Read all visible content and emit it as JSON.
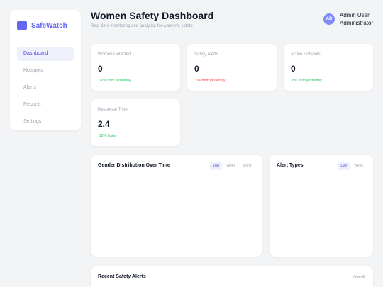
{
  "brand": {
    "name": "SafeWatch"
  },
  "nav": {
    "items": [
      {
        "label": "Dashboard"
      },
      {
        "label": "Hotspots"
      },
      {
        "label": "Alerts"
      },
      {
        "label": "Reports"
      },
      {
        "label": "Settings"
      }
    ]
  },
  "header": {
    "title": "Women Safety Dashboard",
    "subtitle": "Real-time monitoring and analytics for women's safety"
  },
  "user": {
    "initials": "AD",
    "name": "Admin User",
    "role": "Administrator"
  },
  "stats": [
    {
      "label": "Women Detected",
      "value": "0",
      "change": "12% from yesterday",
      "trend": "up"
    },
    {
      "label": "Safety Alerts",
      "value": "0",
      "change": "5% from yesterday",
      "trend": "down"
    },
    {
      "label": "Active Hotspots",
      "value": "0",
      "change": "8% from yesterday",
      "trend": "up"
    },
    {
      "label": "Response Time",
      "value": "2.4",
      "change": "15% faster",
      "trend": "up"
    }
  ],
  "gender_chart": {
    "title": "Gender Distribution Over Time",
    "tabs": [
      "Day",
      "Week",
      "Month"
    ],
    "active_tab": "Day"
  },
  "alert_types": {
    "title": "Alert Types",
    "tabs": [
      "Day",
      "Week"
    ],
    "active_tab": "Day"
  },
  "recent_alerts": {
    "title": "Recent Safety Alerts",
    "view_all": "View All"
  },
  "colors": {
    "accent": "#6366f1",
    "up": "#22c55e",
    "down": "#ef4444"
  }
}
